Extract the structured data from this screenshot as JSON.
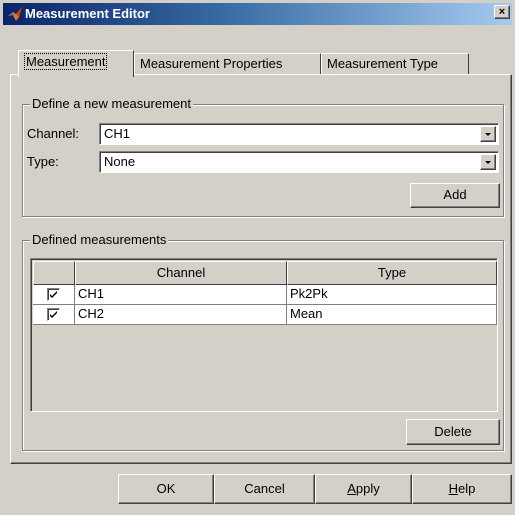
{
  "window": {
    "title": "Measurement Editor",
    "close_label": "×"
  },
  "tabs": [
    {
      "label": "Measurement",
      "active": true
    },
    {
      "label": "Measurement Properties",
      "active": false
    },
    {
      "label": "Measurement Type",
      "active": false
    }
  ],
  "define_group": {
    "legend": "Define a new measurement",
    "channel_label": "Channel:",
    "channel_value": "CH1",
    "type_label": "Type:",
    "type_value": "None",
    "add_button": "Add"
  },
  "defined_group": {
    "legend": "Defined measurements",
    "columns": [
      "",
      "Channel",
      "Type"
    ],
    "rows": [
      {
        "checked": true,
        "channel": "CH1",
        "type": "Pk2Pk"
      },
      {
        "checked": true,
        "channel": "CH2",
        "type": "Mean"
      }
    ],
    "delete_button": "Delete"
  },
  "footer": {
    "ok_label": "OK",
    "cancel_label": "Cancel",
    "apply_prefix": "",
    "apply_mnemonic": "A",
    "apply_rest": "pply",
    "help_prefix": "",
    "help_mnemonic": "H",
    "help_rest": "elp"
  },
  "colors": {
    "titlebar_start": "#0a246a",
    "titlebar_end": "#a6caf0",
    "dialog_face": "#d4d0c8"
  }
}
